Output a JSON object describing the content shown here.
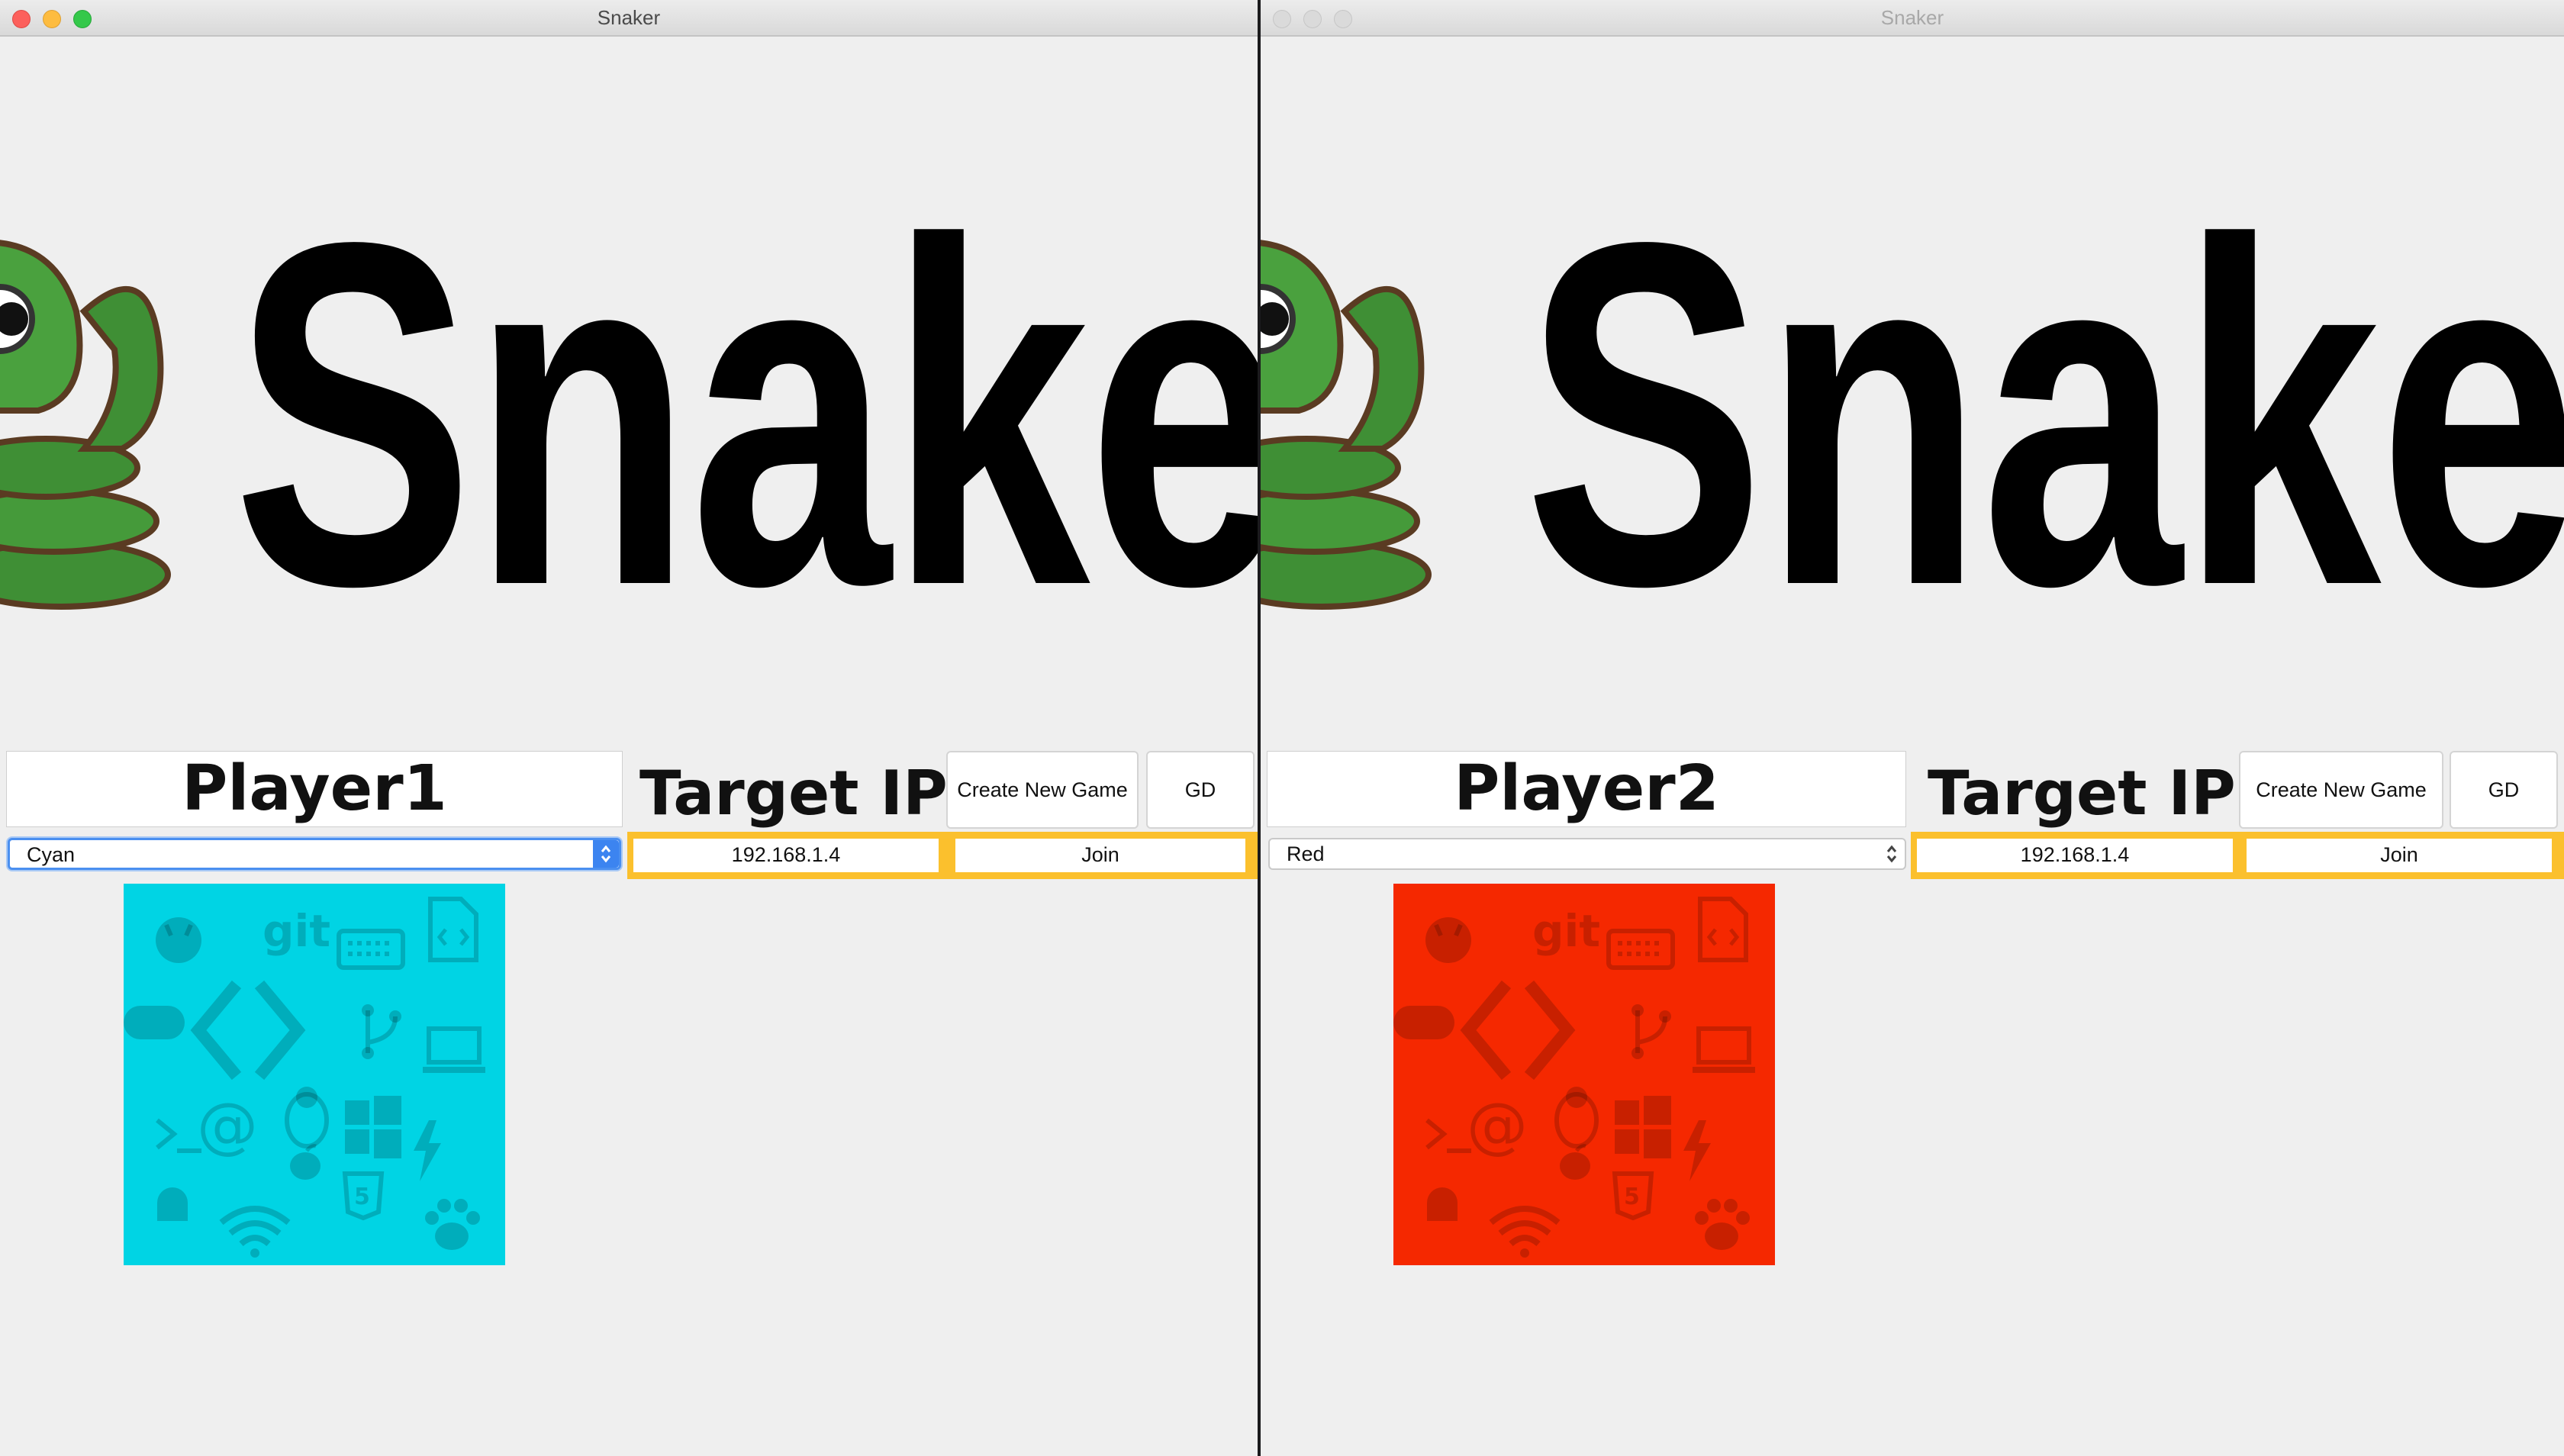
{
  "windows": [
    {
      "title": "Snaker",
      "banner": "Snake",
      "player_name": "Player1",
      "target_ip_label": "Target IP",
      "create_label": "Create New Game",
      "gd_label": "GD",
      "color_select": {
        "value": "Cyan"
      },
      "ip_value": "192.168.1.4",
      "join_label": "Join",
      "preview": {
        "color": "#00d4e4",
        "icons": [
          "github-icon",
          "git-icon",
          "keyboard-icon",
          "code-file-icon",
          "gamepad-icon",
          "code-brackets-icon",
          "branch-icon",
          "laptop-icon",
          "terminal-icon",
          "at-icon",
          "linux-icon",
          "windows-icon",
          "lightning-icon",
          "apple-icon",
          "android-icon",
          "wifi-icon",
          "html5-icon",
          "paw-icon"
        ],
        "git_text": "git"
      }
    },
    {
      "title": "Snaker",
      "banner": "Snake",
      "player_name": "Player2",
      "target_ip_label": "Target IP",
      "create_label": "Create New Game",
      "gd_label": "GD",
      "color_select": {
        "value": "Red"
      },
      "ip_value": "192.168.1.4",
      "join_label": "Join",
      "preview": {
        "color": "#f52800",
        "icons": [
          "github-icon",
          "git-icon",
          "keyboard-icon",
          "code-file-icon",
          "gamepad-icon",
          "code-brackets-icon",
          "branch-icon",
          "laptop-icon",
          "terminal-icon",
          "at-icon",
          "linux-icon",
          "windows-icon",
          "lightning-icon",
          "apple-icon",
          "android-icon",
          "wifi-icon",
          "html5-icon",
          "paw-icon"
        ],
        "git_text": "git"
      }
    }
  ],
  "colors": {
    "accent_yellow": "#fbc02d",
    "focus_blue": "#3c84f0"
  }
}
